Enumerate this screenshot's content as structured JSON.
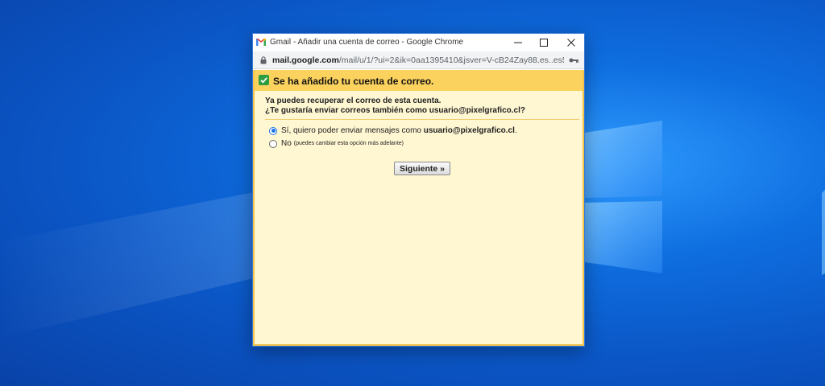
{
  "window": {
    "title": "Gmail - Añadir una cuenta de correo - Google Chrome",
    "url_host": "mail.google.com",
    "url_path": "/mail/u/1/?ui=2&ik=0aa1395410&jsver=V-cB24Zay88.es..es5&c..."
  },
  "banner": {
    "text": "Se ha añadido tu cuenta de correo."
  },
  "message": {
    "line1": "Ya puedes recuperar el correo de esta cuenta.",
    "line2": "¿Te gustaría enviar correos también como usuario@pixelgrafico.cl?"
  },
  "options": [
    {
      "label": "Sí, quiero poder enviar mensajes como",
      "email": "usuario@pixelgrafico.cl",
      "suffix": ".",
      "selected": true
    },
    {
      "label": "No",
      "note": "(puedes cambiar esta opción más adelante)",
      "selected": false
    }
  ],
  "next_button": {
    "label": "Siguiente »"
  },
  "colors": {
    "banner": "#fbd25e",
    "content_background": "#fff6d2",
    "check": "#2e9d3f",
    "radio_accent": "#1a73e8"
  },
  "icons": {
    "title": "gmail-icon",
    "window_controls": [
      "minimize-icon",
      "maximize-icon",
      "close-icon"
    ],
    "address": [
      "lock-icon",
      "key-icon"
    ],
    "banner": "check-icon"
  }
}
